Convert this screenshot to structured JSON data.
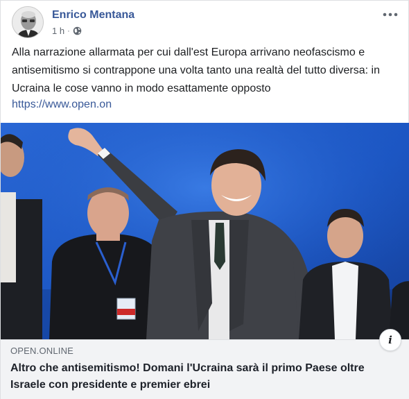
{
  "post": {
    "author": "Enrico Mentana",
    "time": "1 h",
    "separator": "·",
    "privacy_icon": "globe-icon",
    "more_icon": "more-dots-icon",
    "text": "Alla narrazione allarmata per cui dall'est Europa arrivano neofascismo e antisemitismo si contrappone una volta tanto una realtà del tutto diversa: in Ucraina le cose vanno in modo esattamente opposto",
    "link": "https://www.open.on"
  },
  "card": {
    "domain": "OPEN.ONLINE",
    "headline": "Altro che antisemitismo! Domani l'Ucraina sarà il primo Paese oltre Israele con presidente e premier ebrei",
    "info_icon": "info-icon",
    "info_label": "i"
  },
  "colors": {
    "author": "#385898",
    "link": "#385898",
    "stage_blue": "#1e58c4",
    "card_bg": "#f2f3f5"
  }
}
